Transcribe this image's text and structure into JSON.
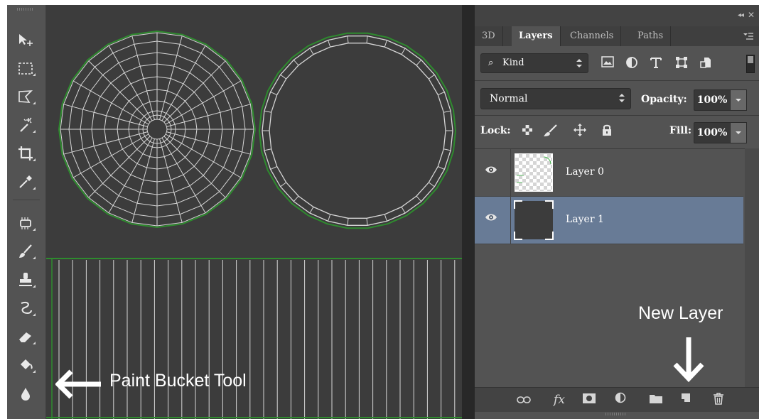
{
  "panel": {
    "tabs": [
      {
        "label": "3D",
        "active": false
      },
      {
        "label": "Layers",
        "active": true
      },
      {
        "label": "Channels",
        "active": false
      },
      {
        "label": "Paths",
        "active": false
      }
    ],
    "filter": {
      "label": "Kind"
    },
    "blend_mode": "Normal",
    "opacity_label": "Opacity:",
    "opacity_value": "100%",
    "lock_label": "Lock:",
    "fill_label": "Fill:",
    "fill_value": "100%",
    "layers": [
      {
        "name": "Layer 0",
        "selected": false,
        "visible": true
      },
      {
        "name": "Layer 1",
        "selected": true,
        "visible": true
      }
    ],
    "selection_color": "#687b96"
  },
  "annotations": {
    "paint_bucket": "Paint Bucket Tool",
    "new_layer": "New Layer"
  },
  "colors": {
    "canvas": "#3c3c3c",
    "wire": "#d6d6d6",
    "uv_border": "#2e8b2e",
    "panel": "#535353"
  }
}
